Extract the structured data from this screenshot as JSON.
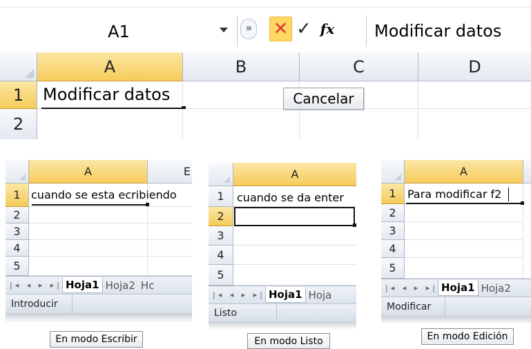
{
  "top": {
    "name_box": "A1",
    "fx_label": "fx",
    "cancel_symbol": "✕",
    "enter_symbol": "✓",
    "formula_content": "Modificar datos",
    "columns": [
      "A",
      "B",
      "C",
      "D"
    ],
    "rows": [
      "1",
      "2"
    ],
    "cell_a1": "Modificar datos",
    "tooltip": "Cancelar"
  },
  "panels": [
    {
      "col_a": "A",
      "col_b": "E",
      "rows": [
        "1",
        "2",
        "3",
        "4",
        "5"
      ],
      "cell_a1": "cuando se esta ecribiendo",
      "tab_nav": "|◂ ◂ ▸ ▸|",
      "tabs": [
        "Hoja1",
        "Hoja2",
        "Hc"
      ],
      "status": "Introducir",
      "caption": "En modo Escribir"
    },
    {
      "col_a": "A",
      "rows": [
        "1",
        "2",
        "3",
        "4",
        "5"
      ],
      "cell_a1": "cuando se da enter",
      "tab_nav": "|◂ ◂ ▸ ▸|",
      "tabs": [
        "Hoja1",
        "Hoja"
      ],
      "status": "Listo",
      "caption": "En modo Listo"
    },
    {
      "col_a": "A",
      "rows": [
        "1",
        "2",
        "3",
        "4",
        "5"
      ],
      "cell_a1": "Para modificar f2",
      "tab_nav": "|◂ ◂ ▸ ▸|",
      "tabs": [
        "Hoja1",
        "Hoja2"
      ],
      "status": "Modificar",
      "caption": "En modo Edición"
    }
  ],
  "colors": {
    "selected_header": "#f6cb5a",
    "cancel_button": "#ffd863",
    "cancel_x": "#e0382d"
  }
}
